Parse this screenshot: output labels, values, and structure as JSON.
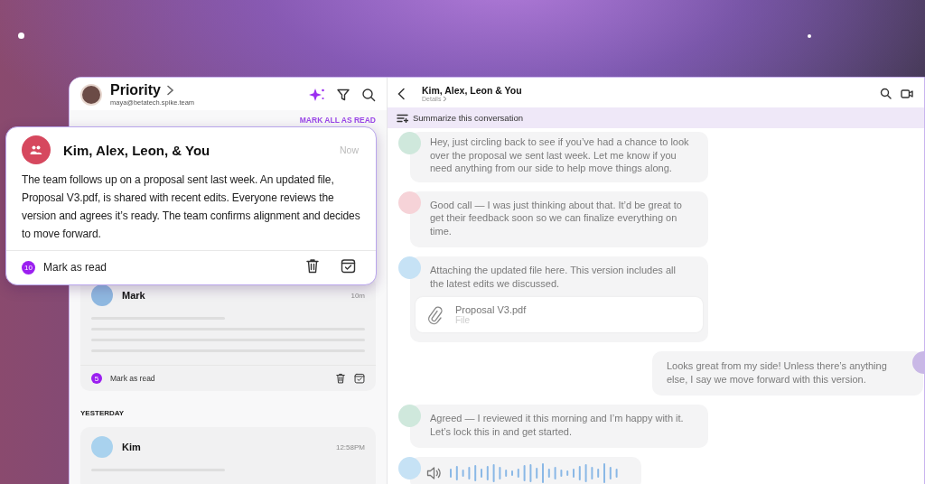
{
  "inbox": {
    "title": "Priority",
    "account": "maya@betatech.spike.team",
    "mark_all": "MARK ALL AS READ",
    "groups": [
      {
        "cards": [
          {
            "sender": "Mark",
            "time": "10m",
            "badge": "5",
            "action": "Mark as read",
            "color": "#8fb8e0"
          }
        ]
      },
      {
        "heading": "YESTERDAY",
        "cards": [
          {
            "sender": "Kim",
            "time": "12:58PM",
            "color": "#a9d2ee"
          }
        ]
      }
    ]
  },
  "popup": {
    "title": "Kim, Alex, Leon, & You",
    "time": "Now",
    "summary": "The team follows up on a proposal sent last week. An updated file, Proposal V3.pdf, is shared with recent edits. Everyone reviews the version and agrees it’s ready. The team confirms alignment and decides to move forward.",
    "badge": "10",
    "action": "Mark as read"
  },
  "conversation": {
    "title": "Kim, Alex, Leon & You",
    "details": "Details",
    "summarize": "Summarize this conversation",
    "messages": [
      {
        "kind": "text",
        "color": "#cfe8dc",
        "text": "Hey, just circling back to see if you’ve had a chance to look over the proposal we sent last week. Let me know if you need anything from our side to help move things along."
      },
      {
        "kind": "text",
        "color": "#f6d3d8",
        "text": "Good call — I was just thinking about that. It’d be great to get their feedback soon so we can finalize everything on time."
      },
      {
        "kind": "attachment",
        "color": "#c6e2f5",
        "text": "Attaching the updated file here. This version includes all the latest edits we discussed.",
        "file_name": "Proposal V3.pdf",
        "file_type": "File"
      },
      {
        "kind": "outgoing",
        "color": "#c9b8e6",
        "text": "Looks great from my side! Unless there’s anything else, I say we move forward with this version."
      },
      {
        "kind": "text",
        "color": "#cfe8dc",
        "text": "Agreed — I reviewed it this morning and I’m happy with it. Let’s lock this in and get started."
      },
      {
        "kind": "voice",
        "color": "#c6e2f5"
      }
    ]
  }
}
